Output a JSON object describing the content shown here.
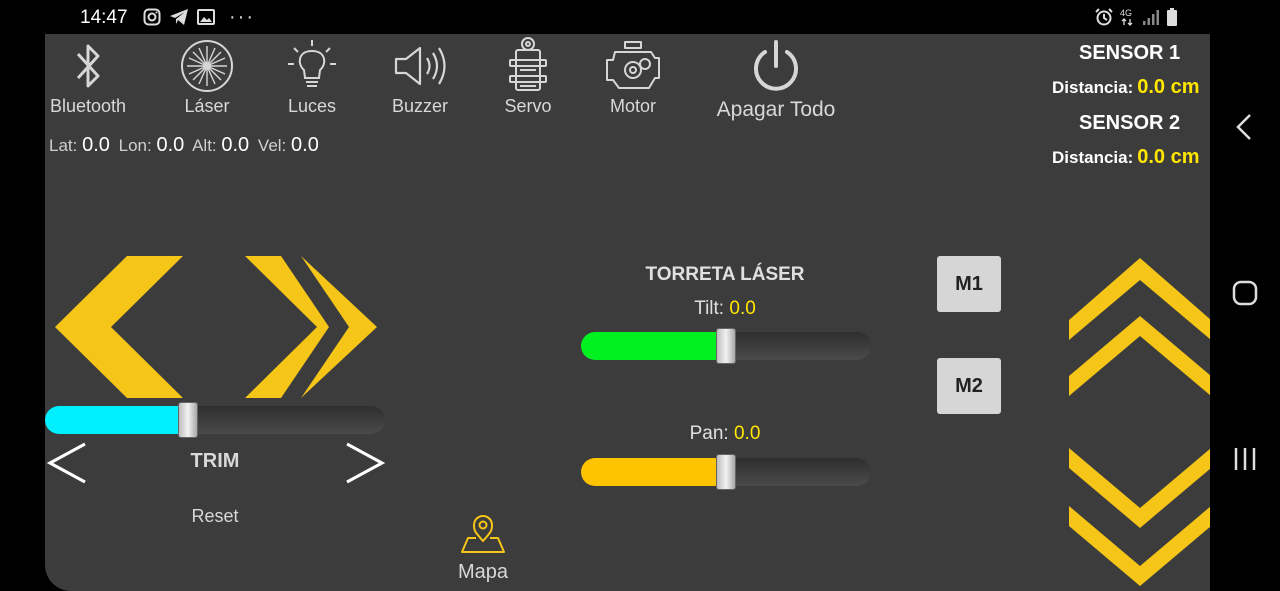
{
  "status_bar": {
    "time": "14:47",
    "left_icons": [
      "instagram-icon",
      "telegram-icon",
      "gallery-icon"
    ],
    "more": "···",
    "network": "4G",
    "right_icons": [
      "alarm-icon",
      "network-4g-icon",
      "signal-icon",
      "battery-icon"
    ]
  },
  "toolbar": {
    "bluetooth": "Bluetooth",
    "laser": "Láser",
    "luces": "Luces",
    "buzzer": "Buzzer",
    "servo": "Servo",
    "motor": "Motor",
    "apagar": "Apagar Todo"
  },
  "gps": {
    "lat_label": "Lat:",
    "lat": "0.0",
    "lon_label": "Lon:",
    "lon": "0.0",
    "alt_label": "Alt:",
    "alt": "0.0",
    "vel_label": "Vel:",
    "vel": "0.0"
  },
  "sensors": {
    "s1_title": "SENSOR 1",
    "s1_label": "Distancia:",
    "s1_value": "0.0 cm",
    "s2_title": "SENSOR 2",
    "s2_label": "Distancia:",
    "s2_value": "0.0 cm"
  },
  "trim": {
    "label": "TRIM",
    "reset": "Reset",
    "level": 0.42
  },
  "torreta": {
    "title": "TORRETA LÁSER",
    "tilt_label": "Tilt:",
    "tilt_value": "0.0",
    "tilt_level": 0.5,
    "pan_label": "Pan:",
    "pan_value": "0.0",
    "pan_level": 0.5
  },
  "memory": {
    "m1": "M1",
    "m2": "M2"
  },
  "map": {
    "label": "Mapa"
  },
  "colors": {
    "background": "#3c3c3c",
    "accent_yellow": "#f5c518",
    "value_yellow": "#ffe600",
    "trim_fill": "#00f0ff",
    "tilt_fill": "#00f020",
    "pan_fill": "#ffc400"
  }
}
